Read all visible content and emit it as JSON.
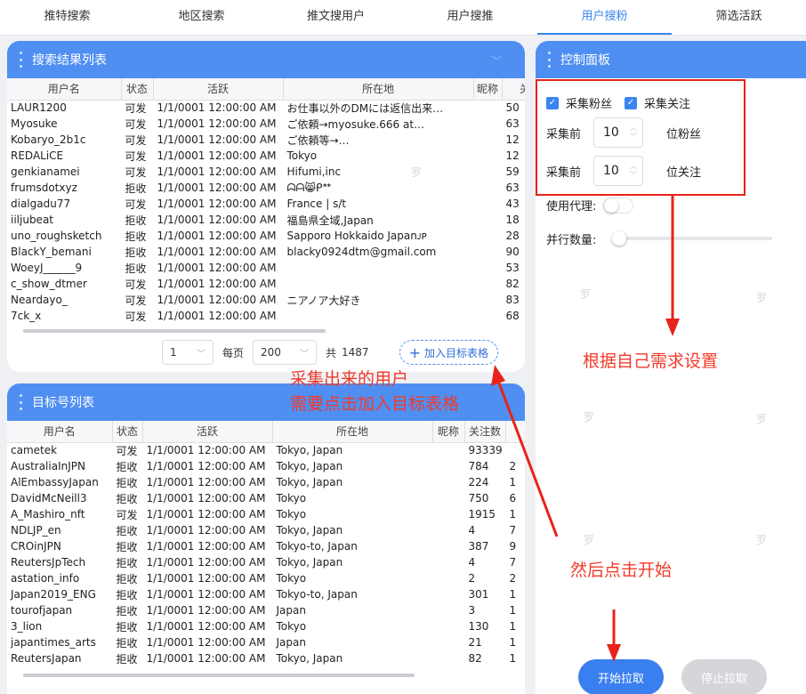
{
  "tabs": [
    {
      "label": "推特搜索"
    },
    {
      "label": "地区搜索"
    },
    {
      "label": "推文搜用户"
    },
    {
      "label": "用户搜推"
    },
    {
      "label": "用户搜粉",
      "active": true
    },
    {
      "label": "筛选活跃"
    }
  ],
  "results": {
    "title": "搜索结果列表",
    "columns": [
      "用户名",
      "状态",
      "活跃",
      "所在地",
      "昵称",
      "关注"
    ],
    "rows": [
      [
        "LAUR1200",
        "可发",
        "1/1/0001 12:00:00 AM",
        "お仕事以外のDMには返信出来…",
        "",
        "50"
      ],
      [
        "Myosuke",
        "可发",
        "1/1/0001 12:00:00 AM",
        "ご依頼→myosuke.666 at…",
        "",
        "63"
      ],
      [
        "Kobaryo_2b1c",
        "可发",
        "1/1/0001 12:00:00 AM",
        "ご依頼等→…",
        "",
        "12"
      ],
      [
        "REDALiCE",
        "可发",
        "1/1/0001 12:00:00 AM",
        "Tokyo",
        "",
        "12"
      ],
      [
        "genkianamei",
        "可发",
        "1/1/0001 12:00:00 AM",
        "Hifumi,inc",
        "",
        "59"
      ],
      [
        "frumsdotxyz",
        "拒收",
        "1/1/0001 12:00:00 AM",
        "ᗣᗩ😸ᑭᕯ",
        "",
        "63"
      ],
      [
        "dialgadu77",
        "可发",
        "1/1/0001 12:00:00 AM",
        "France | s/t",
        "",
        "43"
      ],
      [
        "iiljubeat",
        "拒收",
        "1/1/0001 12:00:00 AM",
        "福島県全域,Japan",
        "",
        "18"
      ],
      [
        "uno_roughsketch",
        "拒收",
        "1/1/0001 12:00:00 AM",
        "Sapporo Hokkaido Japanᴊᴘ",
        "",
        "28"
      ],
      [
        "BlackY_bemani",
        "拒收",
        "1/1/0001 12:00:00 AM",
        "blacky0924dtm@gmail.com",
        "",
        "90"
      ],
      [
        "WoeyJ______9",
        "拒收",
        "1/1/0001 12:00:00 AM",
        "",
        "",
        "53"
      ],
      [
        "c_show_dtmer",
        "可发",
        "1/1/0001 12:00:00 AM",
        "",
        "",
        "82"
      ],
      [
        "Neardayo_",
        "可发",
        "1/1/0001 12:00:00 AM",
        "ニアノア大好き",
        "",
        "83"
      ],
      [
        "7ck_x",
        "可发",
        "1/1/0001 12:00:00 AM",
        "",
        "",
        "68"
      ]
    ],
    "page": "1",
    "per_page_label": "每页",
    "per_page": "200",
    "total_label": "共",
    "total": "1487",
    "add_button": "加入目标表格"
  },
  "targets": {
    "title": "目标号列表",
    "columns": [
      "用户名",
      "状态",
      "活跃",
      "所在地",
      "昵称",
      "关注数",
      ""
    ],
    "rows": [
      [
        "cametek",
        "可发",
        "1/1/0001 12:00:00 AM",
        "Tokyo, Japan",
        "",
        "93339",
        ""
      ],
      [
        "AustraliaInJPN",
        "拒收",
        "1/1/0001 12:00:00 AM",
        "Tokyo, Japan",
        "",
        "784",
        "2"
      ],
      [
        "AlEmbassyJapan",
        "拒收",
        "1/1/0001 12:00:00 AM",
        "Tokyo, Japan",
        "",
        "224",
        "1"
      ],
      [
        "DavidMcNeill3",
        "拒收",
        "1/1/0001 12:00:00 AM",
        "Tokyo",
        "",
        "750",
        "6"
      ],
      [
        "A_Mashiro_nft",
        "可发",
        "1/1/0001 12:00:00 AM",
        "Tokyo",
        "",
        "1915",
        "1"
      ],
      [
        "NDLJP_en",
        "拒收",
        "1/1/0001 12:00:00 AM",
        "Tokyo, Japan",
        "",
        "4",
        "7"
      ],
      [
        "CROinJPN",
        "拒收",
        "1/1/0001 12:00:00 AM",
        "Tokyo-to, Japan",
        "",
        "387",
        "9"
      ],
      [
        "ReutersJpTech",
        "拒收",
        "1/1/0001 12:00:00 AM",
        "Tokyo, Japan",
        "",
        "4",
        "7"
      ],
      [
        "astation_info",
        "拒收",
        "1/1/0001 12:00:00 AM",
        "Tokyo",
        "",
        "2",
        "2"
      ],
      [
        "Japan2019_ENG",
        "拒收",
        "1/1/0001 12:00:00 AM",
        "Tokyo-to, Japan",
        "",
        "301",
        "1"
      ],
      [
        "tourofjapan",
        "拒收",
        "1/1/0001 12:00:00 AM",
        "Japan",
        "",
        "3",
        "1"
      ],
      [
        "3_lion",
        "拒收",
        "1/1/0001 12:00:00 AM",
        "Tokyo",
        "",
        "130",
        "1"
      ],
      [
        "japantimes_arts",
        "拒收",
        "1/1/0001 12:00:00 AM",
        "Japan",
        "",
        "21",
        "1"
      ],
      [
        "ReutersJapan",
        "拒收",
        "1/1/0001 12:00:00 AM",
        "Tokyo, Japan",
        "",
        "82",
        "1"
      ]
    ]
  },
  "control": {
    "title": "控制面板",
    "collect_fans": "采集粉丝",
    "collect_follow": "采集关注",
    "collect_prefix": "采集前",
    "fans_count": "10",
    "fans_suffix": "位粉丝",
    "follow_count": "10",
    "follow_suffix": "位关注",
    "proxy_label": "使用代理:",
    "parallel_label": "并行数量:",
    "parallel_level": 0,
    "start_button": "开始拉取",
    "stop_button": "停止拉取"
  },
  "annotations": {
    "settings": "根据自己需求设置",
    "collected_line1": "采集出来的用户",
    "collected_line2": "需要点击加入目标表格",
    "then_start": "然后点击开始"
  },
  "watermark": "罗",
  "colors": {
    "accent": "#4f8ff2",
    "annotation": "#f23a2a",
    "stop_button": "#d4d6da"
  }
}
